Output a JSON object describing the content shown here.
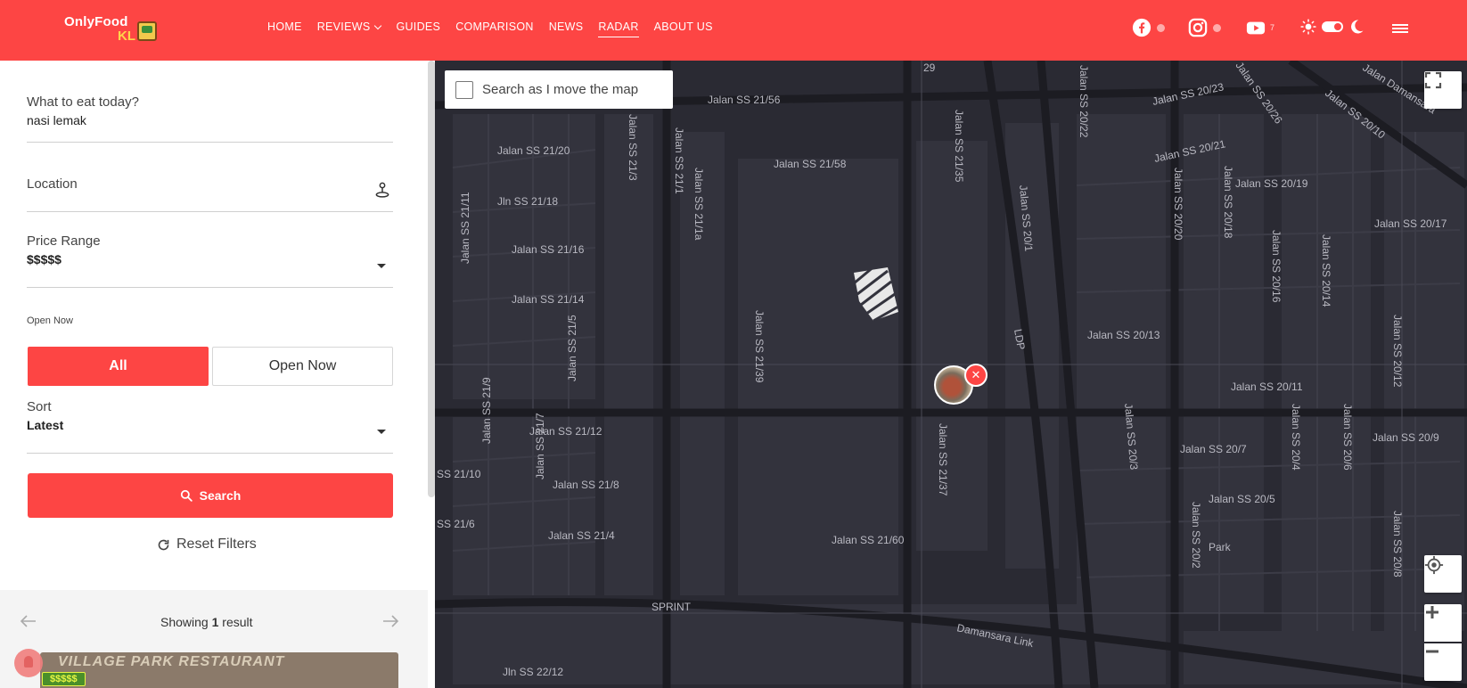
{
  "brand": {
    "name_line1": "OnlyFood",
    "name_line2": "KL",
    "accent": "#fd4544"
  },
  "nav": {
    "items": [
      {
        "label": "HOME"
      },
      {
        "label": "REVIEWS",
        "has_dropdown": true
      },
      {
        "label": "GUIDES"
      },
      {
        "label": "COMPARISON"
      },
      {
        "label": "NEWS"
      },
      {
        "label": "RADAR",
        "active": true
      },
      {
        "label": "ABOUT US"
      }
    ]
  },
  "social": {
    "youtube_count": "7"
  },
  "filters": {
    "what_label": "What to eat today?",
    "what_value": "nasi lemak",
    "location_label": "Location",
    "price_label": "Price Range",
    "price_value": "$$$$$",
    "open_label": "Open Now",
    "open_options": [
      "All",
      "Open Now"
    ],
    "sort_label": "Sort",
    "sort_value": "Latest",
    "search_label": "Search",
    "reset_label": "Reset Filters"
  },
  "results": {
    "showing_prefix": "Showing ",
    "count": "1",
    "showing_suffix": " result",
    "card_sign": "VILLAGE PARK RESTAURANT",
    "card_price": "$$$$$"
  },
  "map": {
    "search_as_move_label": "Search as I move the map",
    "labels": [
      "Jalan SS 21/56",
      "Jalan SS 21/20",
      "Jalan SS 21/58",
      "Jln SS 21/18",
      "Jalan SS 21/16",
      "Jalan SS 21/14",
      "Jalan SS 21/12",
      "Jalan SS 21/8",
      "Jalan SS 21/4",
      "SS 21/10",
      "SS 21/6",
      "Jalan SS 21/60",
      "SPRINT",
      "Damansara Link",
      "Jln SS 22/12",
      "Jalan SS 21/3",
      "Jalan SS 21/1",
      "Jalan SS 21/1a",
      "Jalan SS 21/39",
      "Jalan SS 21/11",
      "Jalan SS 21/9",
      "Jalan SS 21/5",
      "Jalan SS 21/7",
      "Jalan SS 21/35",
      "Jalan SS 21/37",
      "LDP",
      "Jalan SS 20/1",
      "Jalan SS 20/13",
      "Jalan SS 20/11",
      "Jalan SS 20/7",
      "Jalan SS 20/5",
      "Jalan SS 20/3",
      "Jalan SS 20/4",
      "Jalan SS 20/2",
      "Jalan SS 20/6",
      "Jalan SS 20/8",
      "Jalan SS 20/9",
      "Jalan SS 20/12",
      "Jalan SS 20/14",
      "Jalan SS 20/16",
      "Jalan SS 20/18",
      "Jalan SS 20/20",
      "Jalan SS 20/19",
      "Jalan SS 20/17",
      "Jalan SS 20/21",
      "Jalan SS 20/23",
      "Jalan SS 20/22",
      "Jalan SS 20/26",
      "Jalan SS 20/10",
      "Jalan Damansara",
      "Park",
      "29"
    ]
  }
}
